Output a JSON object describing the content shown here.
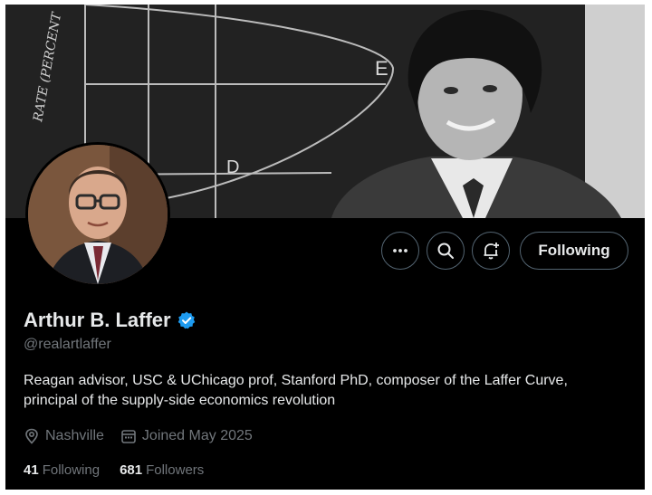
{
  "profile": {
    "name": "Arthur B. Laffer",
    "handle": "@realartlaffer",
    "bio": "Reagan advisor, USC & UChicago prof, Stanford PhD, composer of the Laffer Curve, principal of the supply-side economics revolution",
    "location": "Nashville",
    "joined": "Joined May 2025",
    "following_count": "41",
    "following_label": "Following",
    "followers_count": "681",
    "followers_label": "Followers"
  },
  "actions": {
    "more_icon": "more-horizontal-icon",
    "search_icon": "search-icon",
    "notify_icon": "bell-plus-icon",
    "following_button_label": "Following"
  },
  "banner": {
    "chalk_text_rate": "RATE (PERCENT",
    "chalk_letter_e": "E",
    "chalk_letter_d": "D"
  },
  "colors": {
    "background": "#000000",
    "primary_text": "#e7e9ea",
    "secondary_text": "#71767b",
    "verified_blue": "#1d9bf0",
    "button_border": "#536471"
  }
}
